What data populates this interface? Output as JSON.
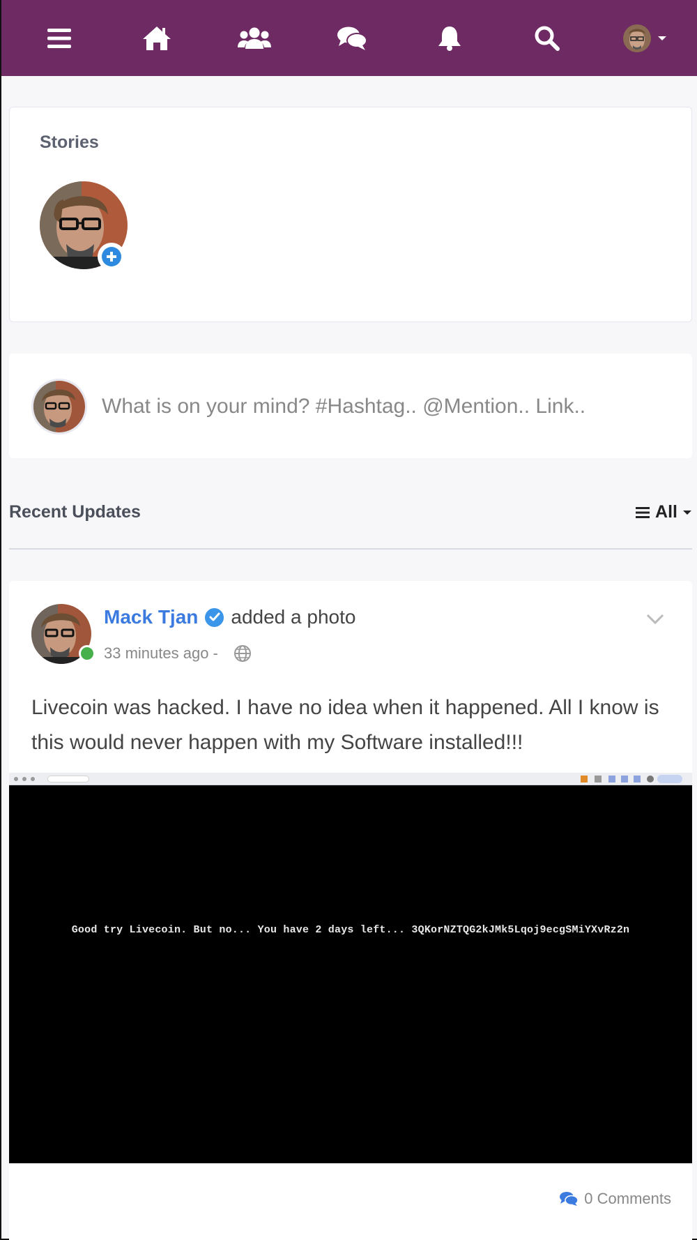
{
  "navbar": {
    "background": "#6e2a63",
    "items": [
      "menu-icon",
      "home-icon",
      "groups-icon",
      "messages-icon",
      "notifications-icon",
      "search-icon",
      "profile-menu"
    ]
  },
  "stories": {
    "title": "Stories"
  },
  "composer": {
    "placeholder": "What is on your mind? #Hashtag.. @Mention.. Link.."
  },
  "feed": {
    "title": "Recent Updates",
    "filter_label": "All"
  },
  "post": {
    "author": "Mack Tjan",
    "action": "added a photo",
    "time": "33 minutes ago -",
    "text": "Livecoin was hacked. I have no idea when it happened. All I know is this would never happen with my Software installed!!!",
    "image_text": "Good try Livecoin. But no... You have 2 days left... 3QKorNZTQG2kJMk5Lqoj9ecgSMiYXvRz2n",
    "comments": "0 Comments"
  },
  "colors": {
    "accent": "#3b7be0",
    "online": "#47b04b",
    "navbar": "#6e2a63"
  }
}
